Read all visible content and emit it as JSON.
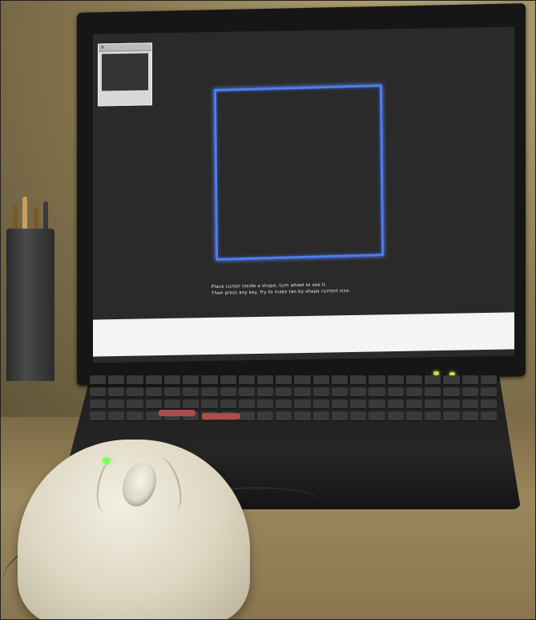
{
  "image": {
    "type": "photo",
    "subject": "laptop-and-mouse"
  },
  "laptop": {
    "screen": {
      "small_window": {
        "close_glyph": "✕"
      },
      "shape_color": "#4f7cf0",
      "text_lines": [
        "Place cursor inside a shape, turn wheel to see it.",
        "Then press any key. Try to make tan by shape current size."
      ]
    },
    "led_color": "#bfe24a"
  },
  "mouse": {
    "led_color": "#7dff57"
  }
}
